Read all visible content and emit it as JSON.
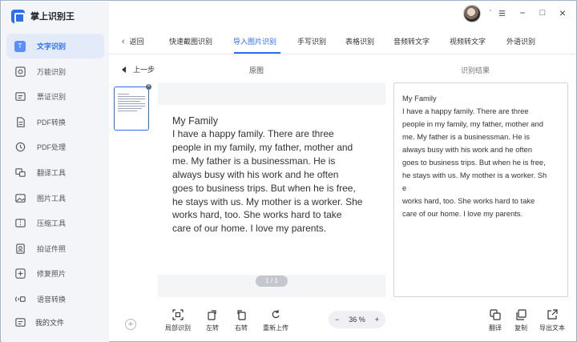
{
  "app": {
    "title": "掌上识别王"
  },
  "sidebar": {
    "items": [
      {
        "label": "文字识别",
        "icon": "text-recognition-icon"
      },
      {
        "label": "万能识别",
        "icon": "universal-scan-icon"
      },
      {
        "label": "票证识别",
        "icon": "ticket-icon"
      },
      {
        "label": "PDF转换",
        "icon": "pdf-convert-icon"
      },
      {
        "label": "PDF处理",
        "icon": "pdf-process-icon"
      },
      {
        "label": "翻译工具",
        "icon": "translate-icon"
      },
      {
        "label": "图片工具",
        "icon": "image-tool-icon"
      },
      {
        "label": "压缩工具",
        "icon": "compress-icon"
      },
      {
        "label": "拍证件照",
        "icon": "id-photo-icon"
      },
      {
        "label": "修复照片",
        "icon": "photo-repair-icon"
      },
      {
        "label": "语音转换",
        "icon": "voice-convert-icon"
      }
    ],
    "myfiles_label": "我的文件"
  },
  "topbar": {
    "dot": "·",
    "minimize": "−",
    "maximize": "□",
    "close": "×"
  },
  "tabs": {
    "back_label": "返回",
    "items": [
      "快速截图识别",
      "导入图片识别",
      "手写识别",
      "表格识别",
      "音频转文字",
      "视频转文字",
      "外语识别"
    ],
    "active": "导入图片识别"
  },
  "panel": {
    "prev_label": "上一步",
    "original_label": "原图",
    "result_label": "识别结果"
  },
  "original_text": {
    "title": "My Family",
    "lines": [
      "I have a happy family. There are three",
      "people in my family, my father, mother and",
      "me. My father is a businessman. He is",
      "always busy with his work and he often",
      "goes to business trips. But when he is free,",
      "he stays with us. My mother is a worker. She",
      "works hard, too. She works hard to take",
      "care of our home. I love my parents."
    ]
  },
  "page_indicator": "1 / 1",
  "result_text": {
    "lines": [
      "My Family",
      "I have a happy family. There are three",
      "people in my family, my father, mother and",
      "me. My father is a businessman. He is",
      "always busy with his work and he often",
      "goes to business trips. But when he is free,",
      "he stays with us. My mother is a worker. Sh",
      "e",
      "works hard, too. She works hard to take",
      "care of our home. I love my parents."
    ]
  },
  "toolbar": {
    "partial_label": "局部识别",
    "rotate_left_label": "左转",
    "rotate_right_label": "右转",
    "reupload_label": "重新上传",
    "zoom_minus": "−",
    "zoom_value": "36 %",
    "zoom_plus": "+",
    "translate_label": "翻译",
    "copy_label": "复制",
    "export_label": "导出文本"
  },
  "colors": {
    "accent": "#2f6df5",
    "sidebar_bg": "#f3f5f8"
  }
}
